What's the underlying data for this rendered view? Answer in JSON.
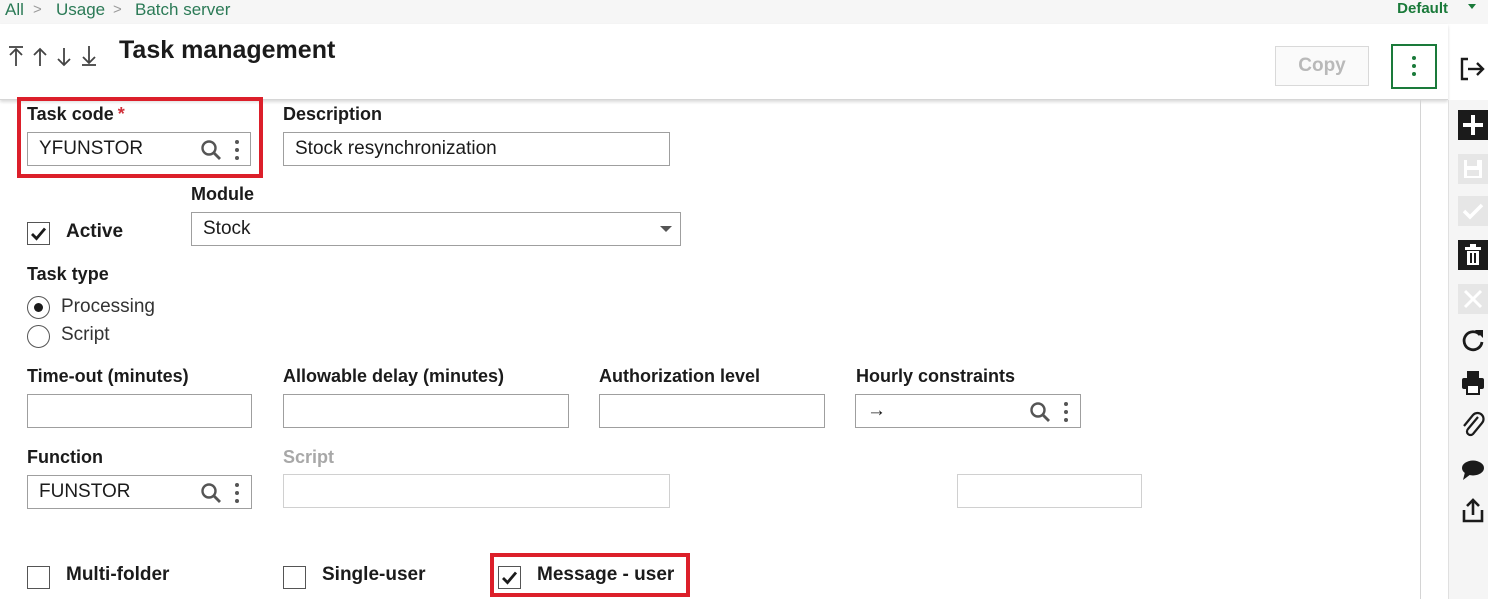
{
  "breadcrumb": {
    "items": [
      "All",
      "Usage",
      "Batch server"
    ],
    "separator": ">"
  },
  "folder": {
    "label": "Default"
  },
  "header": {
    "title": "Task management",
    "copy_label": "Copy"
  },
  "nav_icons": [
    "arrow-first-icon",
    "arrow-up-icon",
    "arrow-down-icon",
    "arrow-last-icon"
  ],
  "form": {
    "task_code": {
      "label": "Task code",
      "required_mark": "*",
      "value": "YFUNSTOR"
    },
    "description": {
      "label": "Description",
      "value": "Stock resynchronization"
    },
    "module": {
      "label": "Module",
      "value": "Stock"
    },
    "active": {
      "label": "Active",
      "checked": true
    },
    "task_type": {
      "label": "Task type",
      "options": [
        "Processing",
        "Script"
      ],
      "selected": "Processing"
    },
    "timeout": {
      "label": "Time-out (minutes)",
      "value": ""
    },
    "allowable_delay": {
      "label": "Allowable delay (minutes)",
      "value": ""
    },
    "authorization_level": {
      "label": "Authorization level",
      "value": ""
    },
    "hourly_constraints": {
      "label": "Hourly constraints",
      "value": "→"
    },
    "function": {
      "label": "Function",
      "value": "FUNSTOR"
    },
    "script": {
      "label": "Script",
      "value": ""
    },
    "extra_field": {
      "value": ""
    },
    "multi_folder": {
      "label": "Multi-folder",
      "checked": false
    },
    "single_user": {
      "label": "Single-user",
      "checked": false
    },
    "message_user": {
      "label": "Message - user",
      "checked": true
    }
  },
  "toolbar": {
    "icons": [
      "add-icon",
      "save-icon",
      "validate-icon",
      "delete-icon",
      "cancel-icon",
      "refresh-icon",
      "print-icon",
      "attachment-icon",
      "comment-icon",
      "export-icon"
    ]
  },
  "colors": {
    "brand_green": "#1a7a3a",
    "link_green": "#2b7a56",
    "highlight_red": "#dc1f2a",
    "required_red": "#d0313b"
  }
}
